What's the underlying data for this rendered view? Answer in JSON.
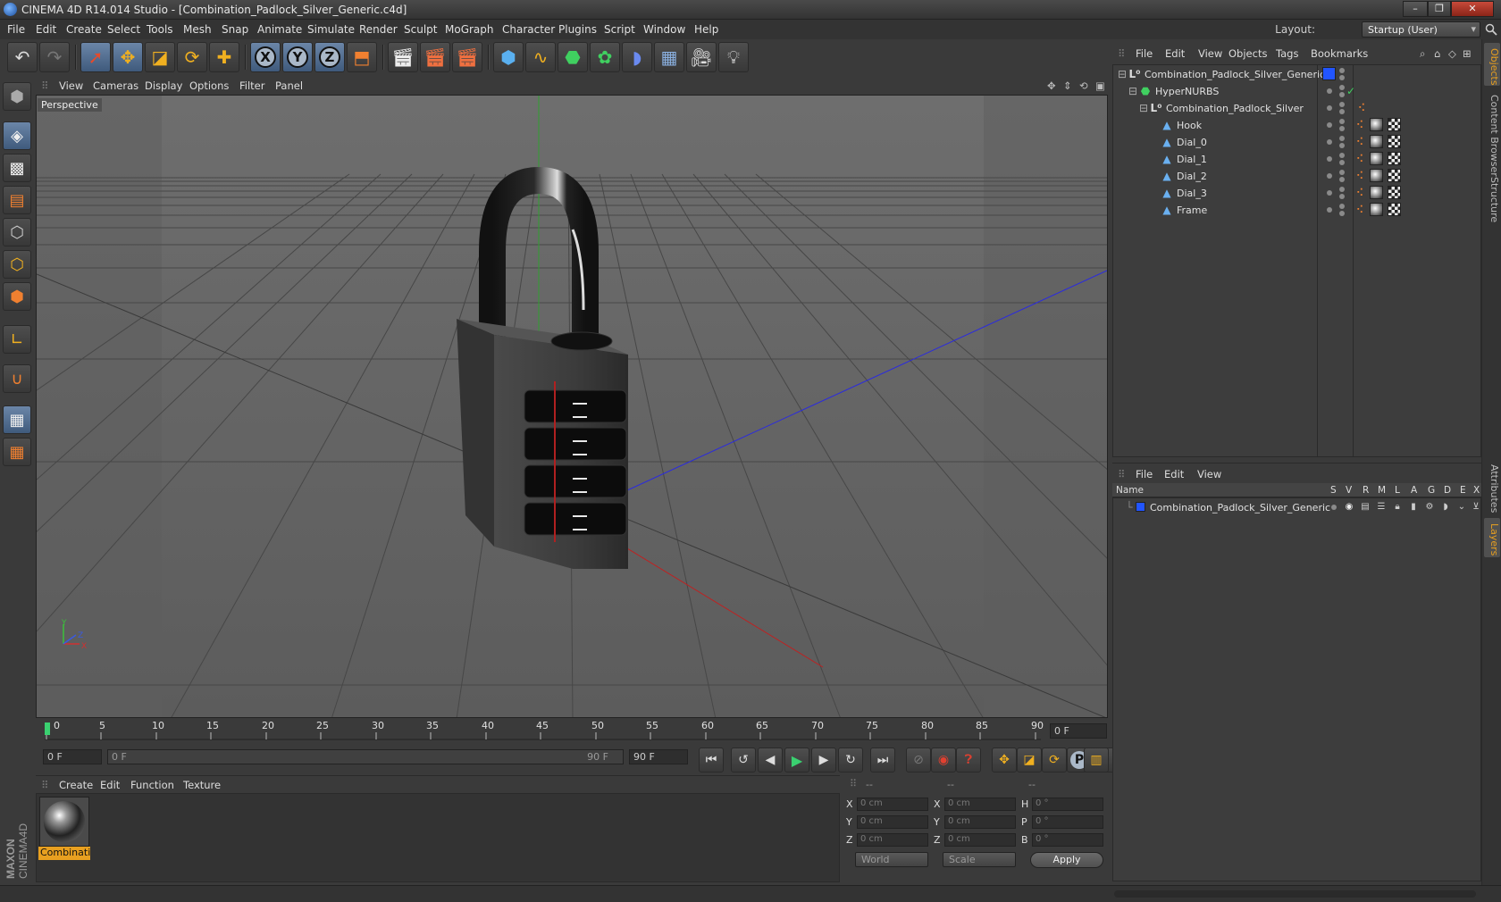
{
  "window": {
    "title": "CINEMA 4D R14.014 Studio - [Combination_Padlock_Silver_Generic.c4d]",
    "controls": [
      "–",
      "❐",
      "✕"
    ]
  },
  "menubar": {
    "items": [
      "File",
      "Edit",
      "Create",
      "Select",
      "Tools",
      "Mesh",
      "Snap",
      "Animate",
      "Simulate",
      "Render",
      "Sculpt",
      "MoGraph",
      "Character",
      "Plugins",
      "Script",
      "Window",
      "Help"
    ],
    "layout_label": "Layout:",
    "layout_value": "Startup (User)"
  },
  "toolbar": {
    "axis_x": "X",
    "axis_y": "Y",
    "axis_z": "Z"
  },
  "viewport": {
    "menu": [
      "View",
      "Cameras",
      "Display",
      "Options",
      "Filter",
      "Panel"
    ],
    "label": "Perspective",
    "axis_x": "X",
    "axis_y": "Y",
    "axis_z": "Z"
  },
  "timeline": {
    "ticks": [
      "0",
      "5",
      "10",
      "15",
      "20",
      "25",
      "30",
      "35",
      "40",
      "45",
      "50",
      "55",
      "60",
      "65",
      "70",
      "75",
      "80",
      "85",
      "90"
    ],
    "current_frame": "0 F",
    "start_field": "0 F",
    "range_start": "0 F",
    "range_end": "90 F",
    "end_field": "90 F"
  },
  "materials": {
    "menu": [
      "Create",
      "Edit",
      "Function",
      "Texture"
    ],
    "items": [
      {
        "name": "Combinatio"
      }
    ]
  },
  "coordinates": {
    "headers": [
      "--",
      "--",
      "--"
    ],
    "rows": [
      {
        "a": "X",
        "av": "0 cm",
        "b": "X",
        "bv": "0 cm",
        "c": "H",
        "cv": "0 °"
      },
      {
        "a": "Y",
        "av": "0 cm",
        "b": "Y",
        "bv": "0 cm",
        "c": "P",
        "cv": "0 °"
      },
      {
        "a": "Z",
        "av": "0 cm",
        "b": "Z",
        "bv": "0 cm",
        "c": "B",
        "cv": "0 °"
      }
    ],
    "mode_world": "World",
    "mode_scale": "Scale",
    "apply": "Apply"
  },
  "object_manager": {
    "menu": [
      "File",
      "Edit",
      "View",
      "Objects",
      "Tags",
      "Bookmarks"
    ],
    "objects": [
      {
        "name": "Combination_Padlock_Silver_Generic",
        "depth": 0,
        "type": "null"
      },
      {
        "name": "HyperNURBS",
        "depth": 1,
        "type": "hypernurbs"
      },
      {
        "name": "Combination_Padlock_Silver",
        "depth": 2,
        "type": "null"
      },
      {
        "name": "Hook",
        "depth": 3,
        "type": "poly"
      },
      {
        "name": "Dial_0",
        "depth": 3,
        "type": "poly"
      },
      {
        "name": "Dial_1",
        "depth": 3,
        "type": "poly"
      },
      {
        "name": "Dial_2",
        "depth": 3,
        "type": "poly"
      },
      {
        "name": "Dial_3",
        "depth": 3,
        "type": "poly"
      },
      {
        "name": "Frame",
        "depth": 3,
        "type": "poly"
      }
    ]
  },
  "layer_manager": {
    "menu": [
      "File",
      "Edit",
      "View"
    ],
    "columns": [
      "Name",
      "S",
      "V",
      "R",
      "M",
      "L",
      "A",
      "G",
      "D",
      "E",
      "X"
    ],
    "layers": [
      {
        "name": "Combination_Padlock_Silver_Generic",
        "color": "#2255ff"
      }
    ]
  },
  "right_tabs": [
    "Objects",
    "Content Browser",
    "Structure",
    "Attributes",
    "Layers"
  ],
  "brand": {
    "logo_text": "MAXON CINEMA 4D"
  },
  "colors": {
    "accent": "#e8a020",
    "layer_blue": "#2255ff",
    "active_tool": "#4f6c91"
  }
}
